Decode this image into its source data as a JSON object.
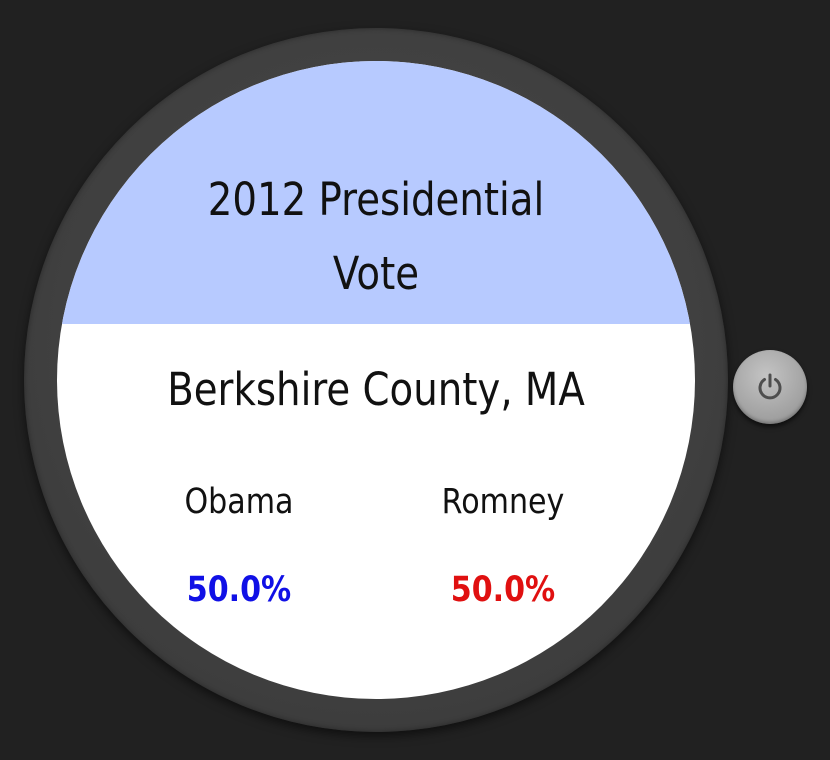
{
  "header": {
    "title_line1": "2012 Presidential",
    "title_line2": "Vote"
  },
  "location": {
    "name": "Berkshire County, MA"
  },
  "candidates": [
    {
      "name": "Obama",
      "percent": "50.0%",
      "color": "#1010e6"
    },
    {
      "name": "Romney",
      "percent": "50.0%",
      "color": "#e01010"
    }
  ],
  "colors": {
    "background": "#212121",
    "header": "#b7caff",
    "screen": "#ffffff"
  },
  "icons": {
    "power": "power-icon"
  }
}
